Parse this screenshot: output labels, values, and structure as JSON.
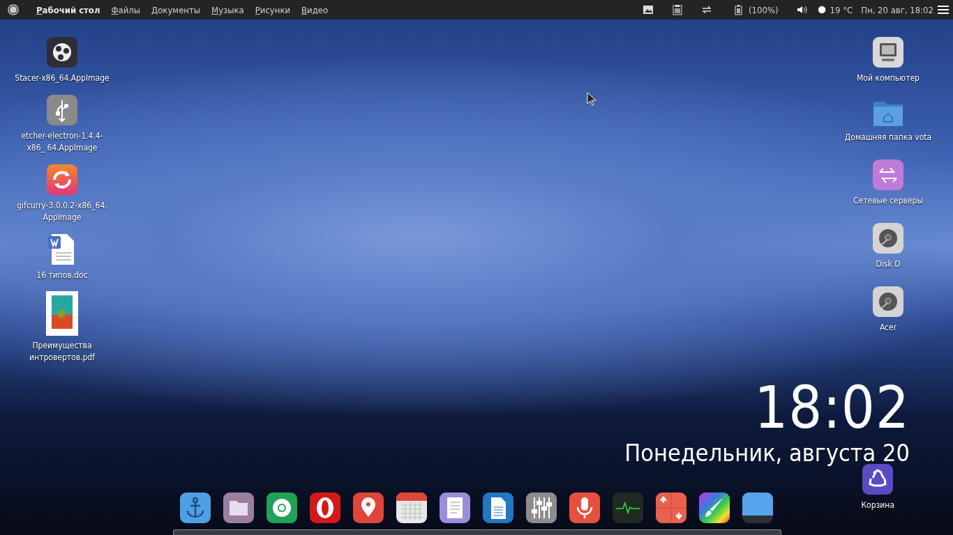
{
  "top_bar": {
    "menu": [
      {
        "label": "Рабочий стол",
        "bold": true
      },
      {
        "label": "Файлы",
        "bold": false
      },
      {
        "label": "Документы",
        "bold": false
      },
      {
        "label": "Музыка",
        "bold": false
      },
      {
        "label": "Рисунки",
        "bold": false
      },
      {
        "label": "Видео",
        "bold": false
      }
    ],
    "battery": "(100%)",
    "weather": "19 °C",
    "datetime": "Пн, 20 авг, 18:02"
  },
  "desktop_left": [
    {
      "kind": "stacer",
      "label": "Stacer-x86_64.AppImage"
    },
    {
      "kind": "usb",
      "label": "etcher-electron-1.4.4-x86_ 64.AppImage"
    },
    {
      "kind": "sync",
      "label": "gifcurry-3.0.0.2-x86_64. AppImage"
    },
    {
      "kind": "doc",
      "label": "16 типов.doc"
    },
    {
      "kind": "pdf",
      "label": "Преимущества интровертов.pdf"
    }
  ],
  "desktop_right": [
    {
      "kind": "computer",
      "label": "Мой компьютер"
    },
    {
      "kind": "home",
      "label": "Домашняя папка vota"
    },
    {
      "kind": "network",
      "label": "Сетевые серверы"
    },
    {
      "kind": "disk",
      "label": "Disk D"
    },
    {
      "kind": "disk",
      "label": "Acer"
    }
  ],
  "trash": {
    "label": "Корзина"
  },
  "clock": {
    "time": "18:02",
    "date": "Понедельник, августа 20"
  },
  "dock": [
    {
      "kind": "anchor"
    },
    {
      "kind": "folder"
    },
    {
      "kind": "chrome"
    },
    {
      "kind": "opera"
    },
    {
      "kind": "maps"
    },
    {
      "kind": "calendar"
    },
    {
      "kind": "notes"
    },
    {
      "kind": "writer"
    },
    {
      "kind": "mixer"
    },
    {
      "kind": "mic"
    },
    {
      "kind": "monitor"
    },
    {
      "kind": "updown"
    },
    {
      "kind": "paint"
    },
    {
      "kind": "window"
    }
  ]
}
